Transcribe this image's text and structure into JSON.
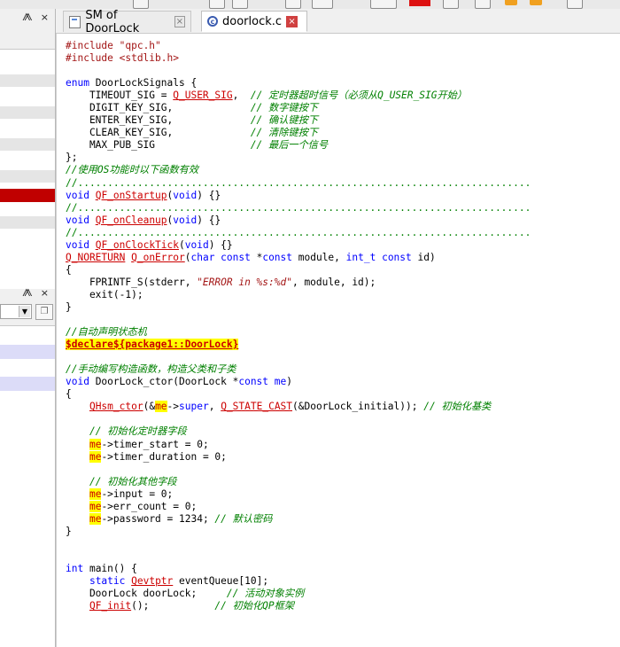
{
  "tabs": [
    {
      "label": "SM of DoorLock",
      "active": false
    },
    {
      "label": "doorlock.c",
      "active": true
    }
  ],
  "left_panel": {
    "pane_controls": "⨇ ×"
  },
  "code_lines": [
    [
      [
        "pp",
        "#include "
      ],
      [
        "str",
        "\"qpc.h\""
      ]
    ],
    [
      [
        "pp",
        "#include <stdlib.h>"
      ]
    ],
    [],
    [
      [
        "kw",
        "enum"
      ],
      [
        "t",
        " DoorLockSignals {"
      ]
    ],
    [
      [
        "t",
        "    TIMEOUT_SIG = "
      ],
      [
        "rf",
        "Q_USER_SIG"
      ],
      [
        "t",
        ",  "
      ],
      [
        "cm",
        "// 定时器超时信号（必须从Q_USER_SIG开始）"
      ]
    ],
    [
      [
        "t",
        "    DIGIT_KEY_SIG,             "
      ],
      [
        "cm",
        "// 数字键按下"
      ]
    ],
    [
      [
        "t",
        "    ENTER_KEY_SIG,             "
      ],
      [
        "cm",
        "// 确认键按下"
      ]
    ],
    [
      [
        "t",
        "    CLEAR_KEY_SIG,             "
      ],
      [
        "cm",
        "// 清除键按下"
      ]
    ],
    [
      [
        "t",
        "    MAX_PUB_SIG                "
      ],
      [
        "cm",
        "// 最后一个信号"
      ]
    ],
    [
      [
        "t",
        "};"
      ]
    ],
    [
      [
        "cm",
        "//使用OS功能时以下函数有效"
      ]
    ],
    [
      [
        "sep",
        "//............................................................................"
      ]
    ],
    [
      [
        "kw",
        "void"
      ],
      [
        "t",
        " "
      ],
      [
        "rf",
        "QF_onStartup"
      ],
      [
        "t",
        "("
      ],
      [
        "kw",
        "void"
      ],
      [
        "t",
        ") {}"
      ]
    ],
    [
      [
        "sep",
        "//............................................................................"
      ]
    ],
    [
      [
        "kw",
        "void"
      ],
      [
        "t",
        " "
      ],
      [
        "rf",
        "QF_onCleanup"
      ],
      [
        "t",
        "("
      ],
      [
        "kw",
        "void"
      ],
      [
        "t",
        ") {}"
      ]
    ],
    [
      [
        "sep",
        "//............................................................................"
      ]
    ],
    [
      [
        "kw",
        "void"
      ],
      [
        "t",
        " "
      ],
      [
        "rf",
        "QF_onClockTick"
      ],
      [
        "t",
        "("
      ],
      [
        "kw",
        "void"
      ],
      [
        "t",
        ") {}"
      ]
    ],
    [
      [
        "rf",
        "Q_NORETURN"
      ],
      [
        "t",
        " "
      ],
      [
        "rf",
        "Q_onError"
      ],
      [
        "t",
        "("
      ],
      [
        "kw",
        "char const"
      ],
      [
        "t",
        " *"
      ],
      [
        "kw",
        "const"
      ],
      [
        "t",
        " module, "
      ],
      [
        "tp",
        "int_t"
      ],
      [
        "t",
        " "
      ],
      [
        "kw",
        "const"
      ],
      [
        "t",
        " id)"
      ]
    ],
    [
      [
        "t",
        "{"
      ]
    ],
    [
      [
        "t",
        "    FPRINTF_S(stderr, "
      ],
      [
        "strc",
        "\"ERROR in %s:%d\""
      ],
      [
        "t",
        ", module, id);"
      ]
    ],
    [
      [
        "t",
        "    exit(-1);"
      ]
    ],
    [
      [
        "t",
        "}"
      ]
    ],
    [],
    [
      [
        "cm",
        "//自动声明状态机"
      ]
    ],
    [
      [
        "macro",
        "$declare${package1::DoorLock}"
      ]
    ],
    [],
    [
      [
        "cm",
        "//手动编写构造函数，构造父类和子类"
      ]
    ],
    [
      [
        "kw",
        "void"
      ],
      [
        "t",
        " DoorLock_ctor(DoorLock *"
      ],
      [
        "kw",
        "const"
      ],
      [
        "t",
        " "
      ],
      [
        "kw",
        "me"
      ],
      [
        "t",
        ")"
      ]
    ],
    [
      [
        "t",
        "{"
      ]
    ],
    [
      [
        "t",
        "    "
      ],
      [
        "rf",
        "QHsm_ctor"
      ],
      [
        "t",
        "(&"
      ],
      [
        "me",
        "me"
      ],
      [
        "t",
        "->"
      ],
      [
        "kw",
        "super"
      ],
      [
        "t",
        ", "
      ],
      [
        "rf",
        "Q_STATE_CAST"
      ],
      [
        "t",
        "(&DoorLock_initial)); "
      ],
      [
        "cm",
        "// 初始化基类"
      ]
    ],
    [],
    [
      [
        "t",
        "    "
      ],
      [
        "cm",
        "// 初始化定时器字段"
      ]
    ],
    [
      [
        "t",
        "    "
      ],
      [
        "me",
        "me"
      ],
      [
        "t",
        "->timer_start = 0;"
      ]
    ],
    [
      [
        "t",
        "    "
      ],
      [
        "me",
        "me"
      ],
      [
        "t",
        "->timer_duration = 0;"
      ]
    ],
    [],
    [
      [
        "t",
        "    "
      ],
      [
        "cm",
        "// 初始化其他字段"
      ]
    ],
    [
      [
        "t",
        "    "
      ],
      [
        "me",
        "me"
      ],
      [
        "t",
        "->input = 0;"
      ]
    ],
    [
      [
        "t",
        "    "
      ],
      [
        "me",
        "me"
      ],
      [
        "t",
        "->err_count = 0;"
      ]
    ],
    [
      [
        "t",
        "    "
      ],
      [
        "me",
        "me"
      ],
      [
        "t",
        "->password = 1234; "
      ],
      [
        "cm",
        "// 默认密码"
      ]
    ],
    [
      [
        "t",
        "}"
      ]
    ],
    [],
    [],
    [
      [
        "kw",
        "int"
      ],
      [
        "t",
        " main() {"
      ]
    ],
    [
      [
        "t",
        "    "
      ],
      [
        "kw",
        "static"
      ],
      [
        "t",
        " "
      ],
      [
        "rf",
        "Qevtptr"
      ],
      [
        "t",
        " eventQueue[10];"
      ]
    ],
    [
      [
        "t",
        "    DoorLock doorLock;     "
      ],
      [
        "cm",
        "// 活动对象实例"
      ]
    ],
    [
      [
        "t",
        "    "
      ],
      [
        "rf",
        "QF_init"
      ],
      [
        "t",
        "();           "
      ],
      [
        "cm",
        "// 初始化QP框架"
      ]
    ]
  ]
}
